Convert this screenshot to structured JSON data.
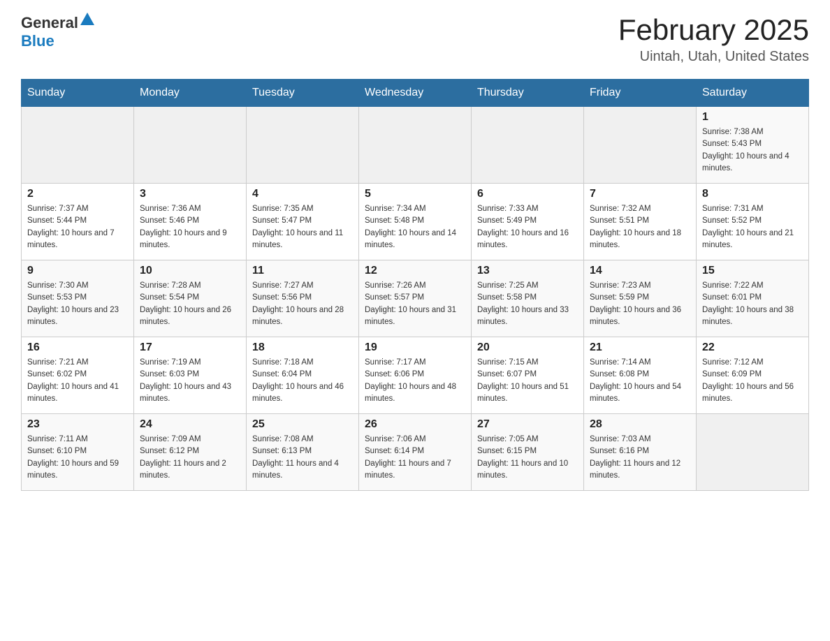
{
  "header": {
    "logo_general": "General",
    "logo_blue": "Blue",
    "month_title": "February 2025",
    "location": "Uintah, Utah, United States"
  },
  "weekdays": [
    "Sunday",
    "Monday",
    "Tuesday",
    "Wednesday",
    "Thursday",
    "Friday",
    "Saturday"
  ],
  "weeks": [
    {
      "days": [
        {
          "number": "",
          "sunrise": "",
          "sunset": "",
          "daylight": ""
        },
        {
          "number": "",
          "sunrise": "",
          "sunset": "",
          "daylight": ""
        },
        {
          "number": "",
          "sunrise": "",
          "sunset": "",
          "daylight": ""
        },
        {
          "number": "",
          "sunrise": "",
          "sunset": "",
          "daylight": ""
        },
        {
          "number": "",
          "sunrise": "",
          "sunset": "",
          "daylight": ""
        },
        {
          "number": "",
          "sunrise": "",
          "sunset": "",
          "daylight": ""
        },
        {
          "number": "1",
          "sunrise": "Sunrise: 7:38 AM",
          "sunset": "Sunset: 5:43 PM",
          "daylight": "Daylight: 10 hours and 4 minutes."
        }
      ]
    },
    {
      "days": [
        {
          "number": "2",
          "sunrise": "Sunrise: 7:37 AM",
          "sunset": "Sunset: 5:44 PM",
          "daylight": "Daylight: 10 hours and 7 minutes."
        },
        {
          "number": "3",
          "sunrise": "Sunrise: 7:36 AM",
          "sunset": "Sunset: 5:46 PM",
          "daylight": "Daylight: 10 hours and 9 minutes."
        },
        {
          "number": "4",
          "sunrise": "Sunrise: 7:35 AM",
          "sunset": "Sunset: 5:47 PM",
          "daylight": "Daylight: 10 hours and 11 minutes."
        },
        {
          "number": "5",
          "sunrise": "Sunrise: 7:34 AM",
          "sunset": "Sunset: 5:48 PM",
          "daylight": "Daylight: 10 hours and 14 minutes."
        },
        {
          "number": "6",
          "sunrise": "Sunrise: 7:33 AM",
          "sunset": "Sunset: 5:49 PM",
          "daylight": "Daylight: 10 hours and 16 minutes."
        },
        {
          "number": "7",
          "sunrise": "Sunrise: 7:32 AM",
          "sunset": "Sunset: 5:51 PM",
          "daylight": "Daylight: 10 hours and 18 minutes."
        },
        {
          "number": "8",
          "sunrise": "Sunrise: 7:31 AM",
          "sunset": "Sunset: 5:52 PM",
          "daylight": "Daylight: 10 hours and 21 minutes."
        }
      ]
    },
    {
      "days": [
        {
          "number": "9",
          "sunrise": "Sunrise: 7:30 AM",
          "sunset": "Sunset: 5:53 PM",
          "daylight": "Daylight: 10 hours and 23 minutes."
        },
        {
          "number": "10",
          "sunrise": "Sunrise: 7:28 AM",
          "sunset": "Sunset: 5:54 PM",
          "daylight": "Daylight: 10 hours and 26 minutes."
        },
        {
          "number": "11",
          "sunrise": "Sunrise: 7:27 AM",
          "sunset": "Sunset: 5:56 PM",
          "daylight": "Daylight: 10 hours and 28 minutes."
        },
        {
          "number": "12",
          "sunrise": "Sunrise: 7:26 AM",
          "sunset": "Sunset: 5:57 PM",
          "daylight": "Daylight: 10 hours and 31 minutes."
        },
        {
          "number": "13",
          "sunrise": "Sunrise: 7:25 AM",
          "sunset": "Sunset: 5:58 PM",
          "daylight": "Daylight: 10 hours and 33 minutes."
        },
        {
          "number": "14",
          "sunrise": "Sunrise: 7:23 AM",
          "sunset": "Sunset: 5:59 PM",
          "daylight": "Daylight: 10 hours and 36 minutes."
        },
        {
          "number": "15",
          "sunrise": "Sunrise: 7:22 AM",
          "sunset": "Sunset: 6:01 PM",
          "daylight": "Daylight: 10 hours and 38 minutes."
        }
      ]
    },
    {
      "days": [
        {
          "number": "16",
          "sunrise": "Sunrise: 7:21 AM",
          "sunset": "Sunset: 6:02 PM",
          "daylight": "Daylight: 10 hours and 41 minutes."
        },
        {
          "number": "17",
          "sunrise": "Sunrise: 7:19 AM",
          "sunset": "Sunset: 6:03 PM",
          "daylight": "Daylight: 10 hours and 43 minutes."
        },
        {
          "number": "18",
          "sunrise": "Sunrise: 7:18 AM",
          "sunset": "Sunset: 6:04 PM",
          "daylight": "Daylight: 10 hours and 46 minutes."
        },
        {
          "number": "19",
          "sunrise": "Sunrise: 7:17 AM",
          "sunset": "Sunset: 6:06 PM",
          "daylight": "Daylight: 10 hours and 48 minutes."
        },
        {
          "number": "20",
          "sunrise": "Sunrise: 7:15 AM",
          "sunset": "Sunset: 6:07 PM",
          "daylight": "Daylight: 10 hours and 51 minutes."
        },
        {
          "number": "21",
          "sunrise": "Sunrise: 7:14 AM",
          "sunset": "Sunset: 6:08 PM",
          "daylight": "Daylight: 10 hours and 54 minutes."
        },
        {
          "number": "22",
          "sunrise": "Sunrise: 7:12 AM",
          "sunset": "Sunset: 6:09 PM",
          "daylight": "Daylight: 10 hours and 56 minutes."
        }
      ]
    },
    {
      "days": [
        {
          "number": "23",
          "sunrise": "Sunrise: 7:11 AM",
          "sunset": "Sunset: 6:10 PM",
          "daylight": "Daylight: 10 hours and 59 minutes."
        },
        {
          "number": "24",
          "sunrise": "Sunrise: 7:09 AM",
          "sunset": "Sunset: 6:12 PM",
          "daylight": "Daylight: 11 hours and 2 minutes."
        },
        {
          "number": "25",
          "sunrise": "Sunrise: 7:08 AM",
          "sunset": "Sunset: 6:13 PM",
          "daylight": "Daylight: 11 hours and 4 minutes."
        },
        {
          "number": "26",
          "sunrise": "Sunrise: 7:06 AM",
          "sunset": "Sunset: 6:14 PM",
          "daylight": "Daylight: 11 hours and 7 minutes."
        },
        {
          "number": "27",
          "sunrise": "Sunrise: 7:05 AM",
          "sunset": "Sunset: 6:15 PM",
          "daylight": "Daylight: 11 hours and 10 minutes."
        },
        {
          "number": "28",
          "sunrise": "Sunrise: 7:03 AM",
          "sunset": "Sunset: 6:16 PM",
          "daylight": "Daylight: 11 hours and 12 minutes."
        },
        {
          "number": "",
          "sunrise": "",
          "sunset": "",
          "daylight": ""
        }
      ]
    }
  ]
}
